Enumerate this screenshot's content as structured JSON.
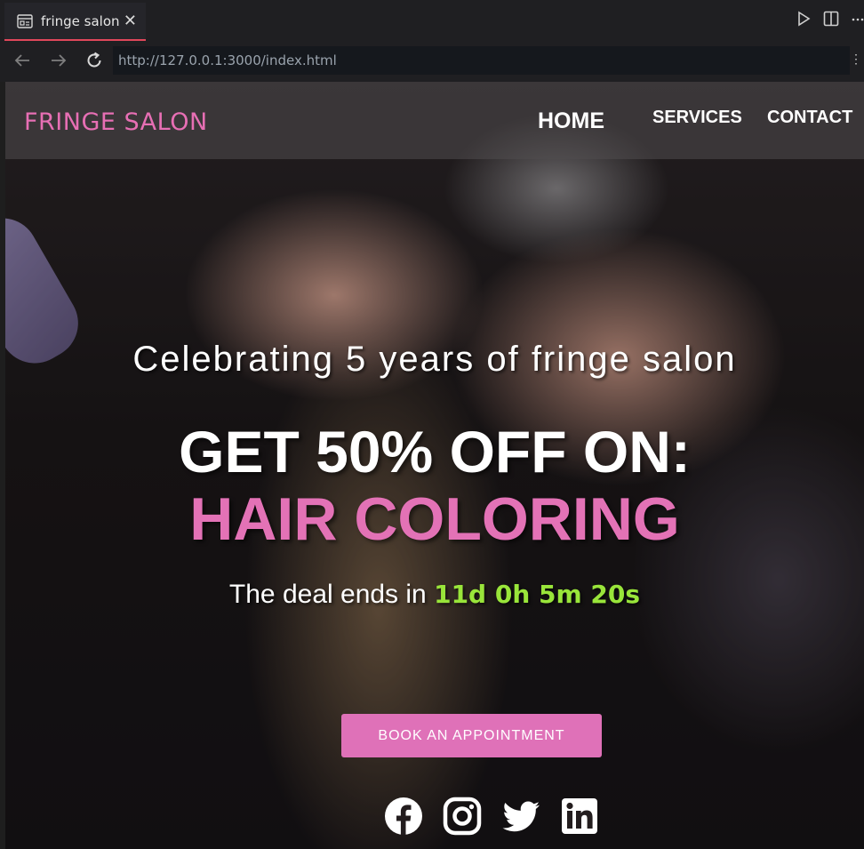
{
  "editor": {
    "tab_title": "fringe salon",
    "close_glyph": "✕",
    "actions": [
      "run-icon",
      "split-editor-icon",
      "more-icon"
    ]
  },
  "browser": {
    "url": "http://127.0.0.1:3000/index.html",
    "back_icon": "arrow-left-icon",
    "forward_icon": "arrow-right-icon",
    "reload_icon": "reload-icon"
  },
  "site": {
    "logo": "FRINGE SALON",
    "nav": {
      "home": "HOME",
      "services": "SERVICES",
      "contact": "CONTACT"
    },
    "hero": {
      "tagline": "Celebrating 5 years of fringe salon",
      "headline": "GET 50% OFF ON:",
      "subhead": "HAIR COLORING",
      "deal_prefix": "The deal ends in",
      "countdown": "11d 0h 5m 20s",
      "cta": "BOOK AN APPOINTMENT"
    },
    "socials": [
      "facebook-icon",
      "instagram-icon",
      "twitter-icon",
      "linkedin-icon"
    ]
  },
  "colors": {
    "accent_pink": "#e372b6",
    "countdown_green": "#99e53a",
    "tab_underline": "#e0475b"
  }
}
